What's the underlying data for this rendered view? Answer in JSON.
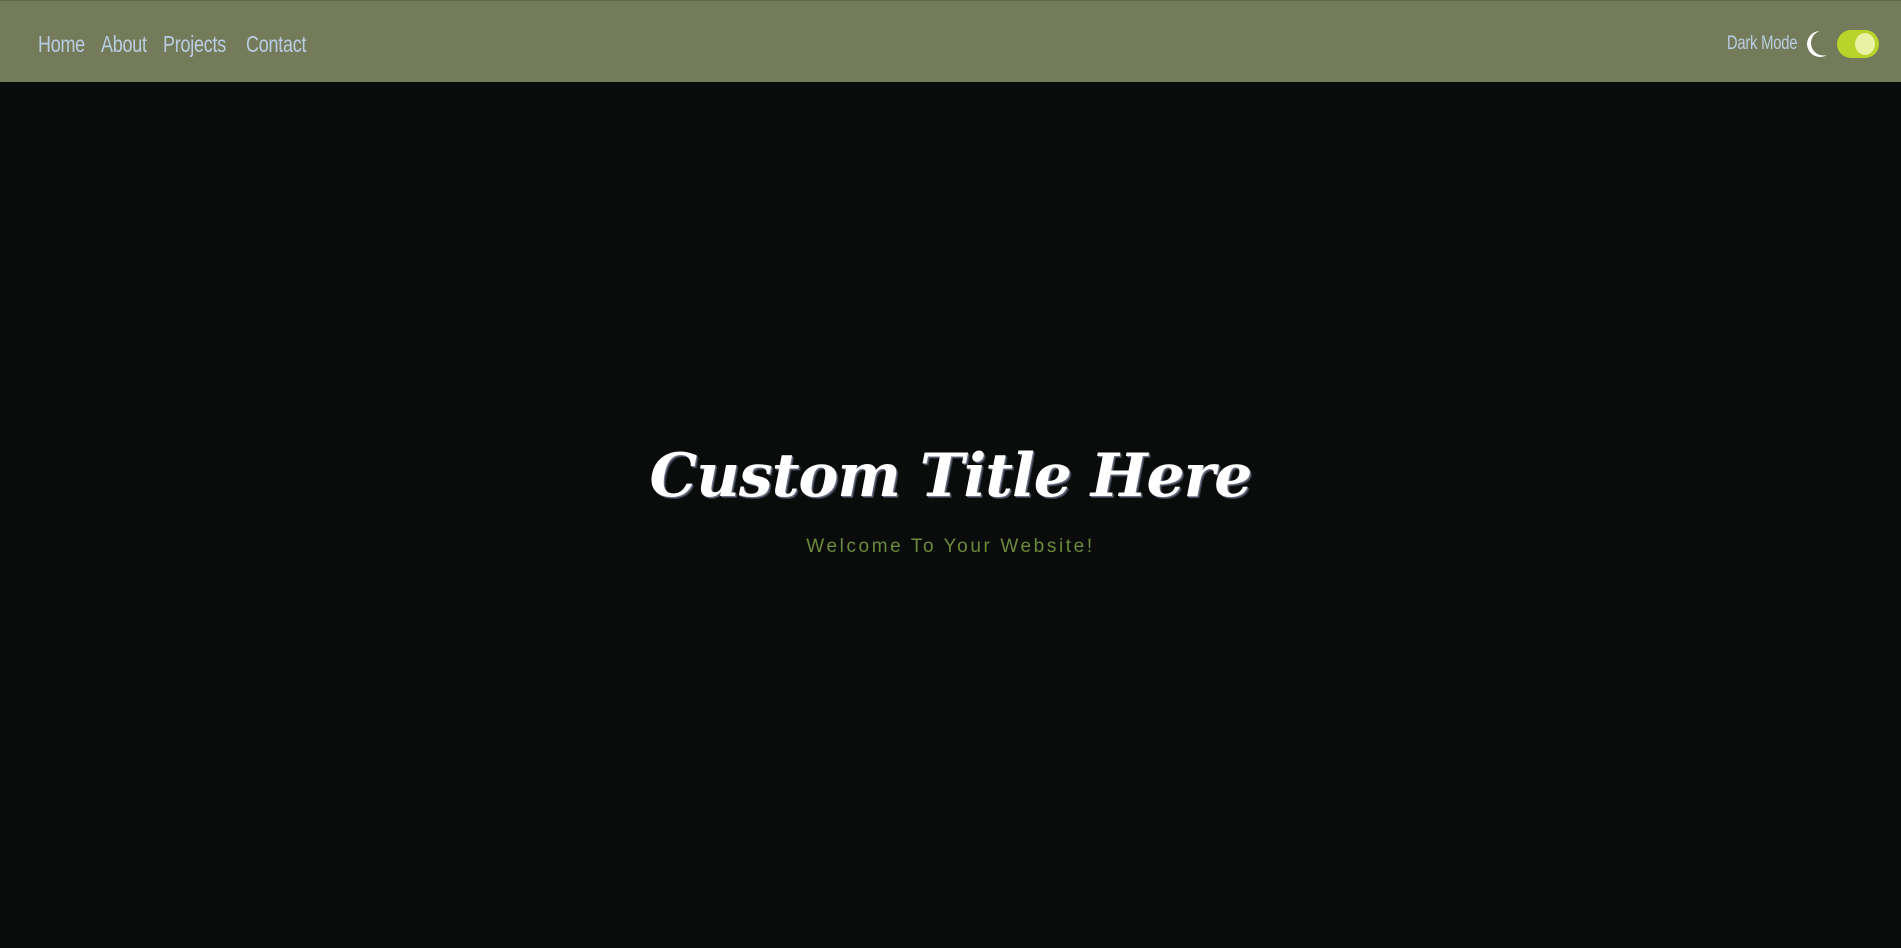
{
  "nav": {
    "links": [
      "Home",
      "About",
      "Projects",
      "Contact"
    ],
    "dark_mode_label": "Dark Mode",
    "dark_mode_enabled": true,
    "icons": {
      "mode": "moon-icon"
    }
  },
  "hero": {
    "title": "Custom Title Here",
    "subtitle": "Welcome To Your Website!"
  },
  "colors": {
    "navbar_bg": "#737b5a",
    "nav_text": "#b9cde0",
    "page_bg": "#0a0b0b",
    "toggle_on": "#b8d42b",
    "subtitle": "#6b8a3a",
    "title": "#ffffff"
  }
}
